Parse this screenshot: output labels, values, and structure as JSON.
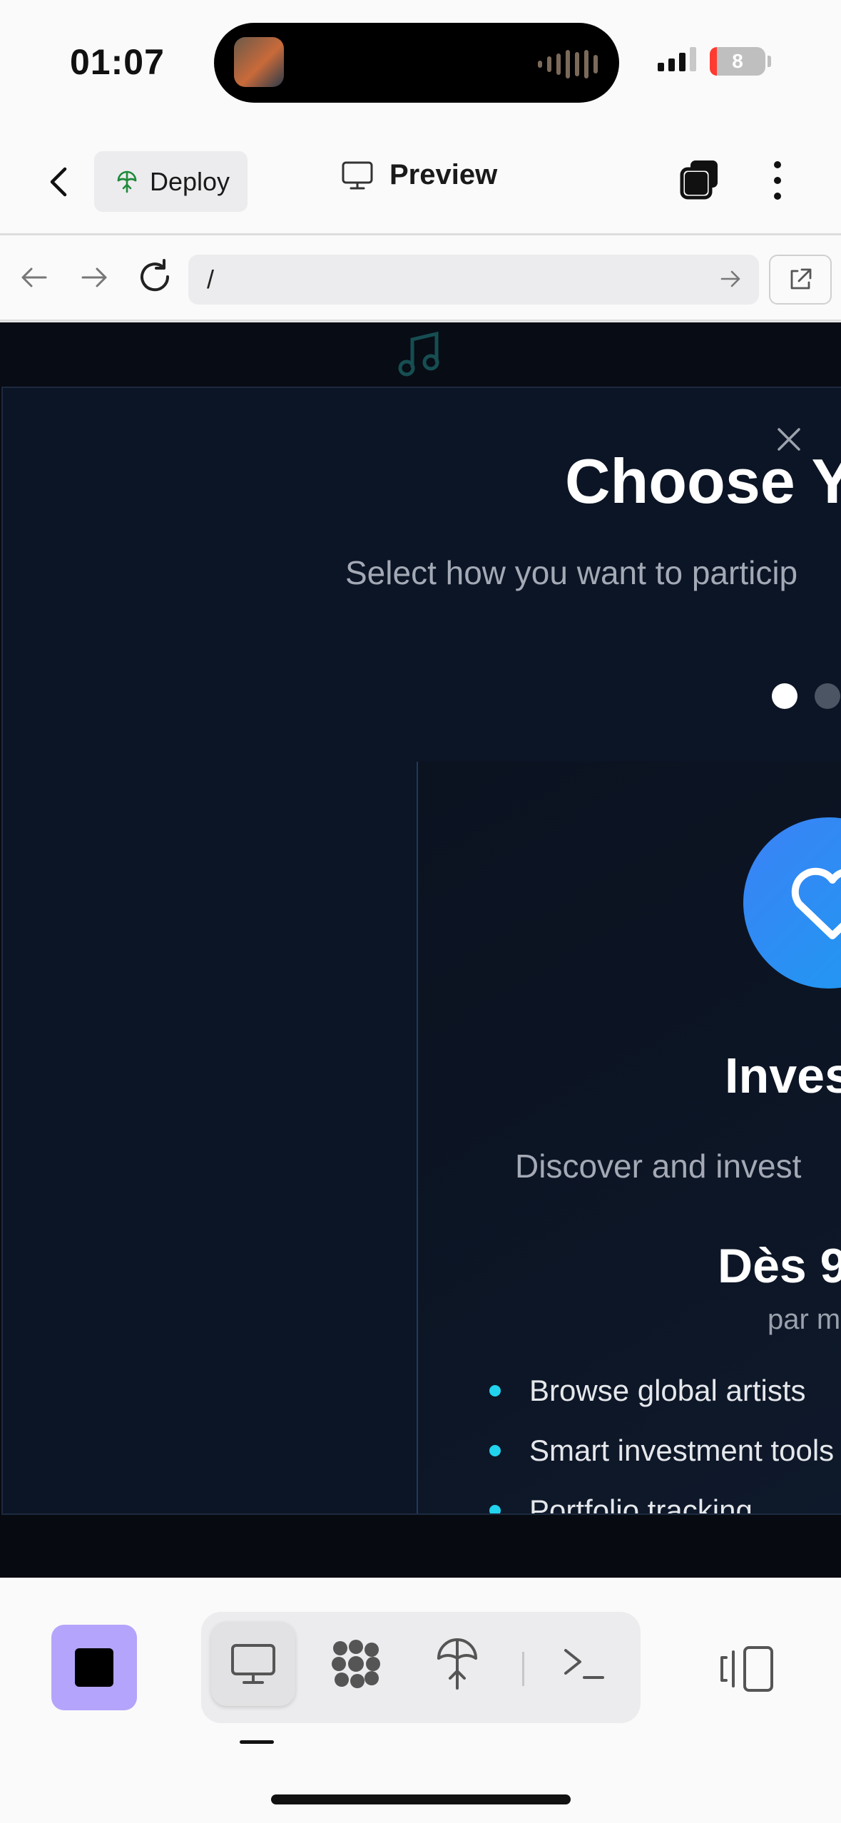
{
  "status_bar": {
    "time": "01:07",
    "battery_level": "8"
  },
  "header": {
    "deploy_label": "Deploy",
    "preview_label": "Preview"
  },
  "browser": {
    "url": "/"
  },
  "modal": {
    "title": "Choose Y",
    "subtitle": "Select how you want to particip",
    "card": {
      "title": "Inves",
      "description": "Discover and invest",
      "price": "Dès 9",
      "price_period": "par m",
      "features": [
        "Browse global artists",
        "Smart investment tools",
        "Portfolio tracking"
      ]
    }
  },
  "colors": {
    "accent_purple": "#b5a4fb",
    "feature_dot": "#22d3ee",
    "modal_bg": "#0c1525",
    "icon_blue": "#3b82f6",
    "deploy_green": "#1f8a3a"
  }
}
